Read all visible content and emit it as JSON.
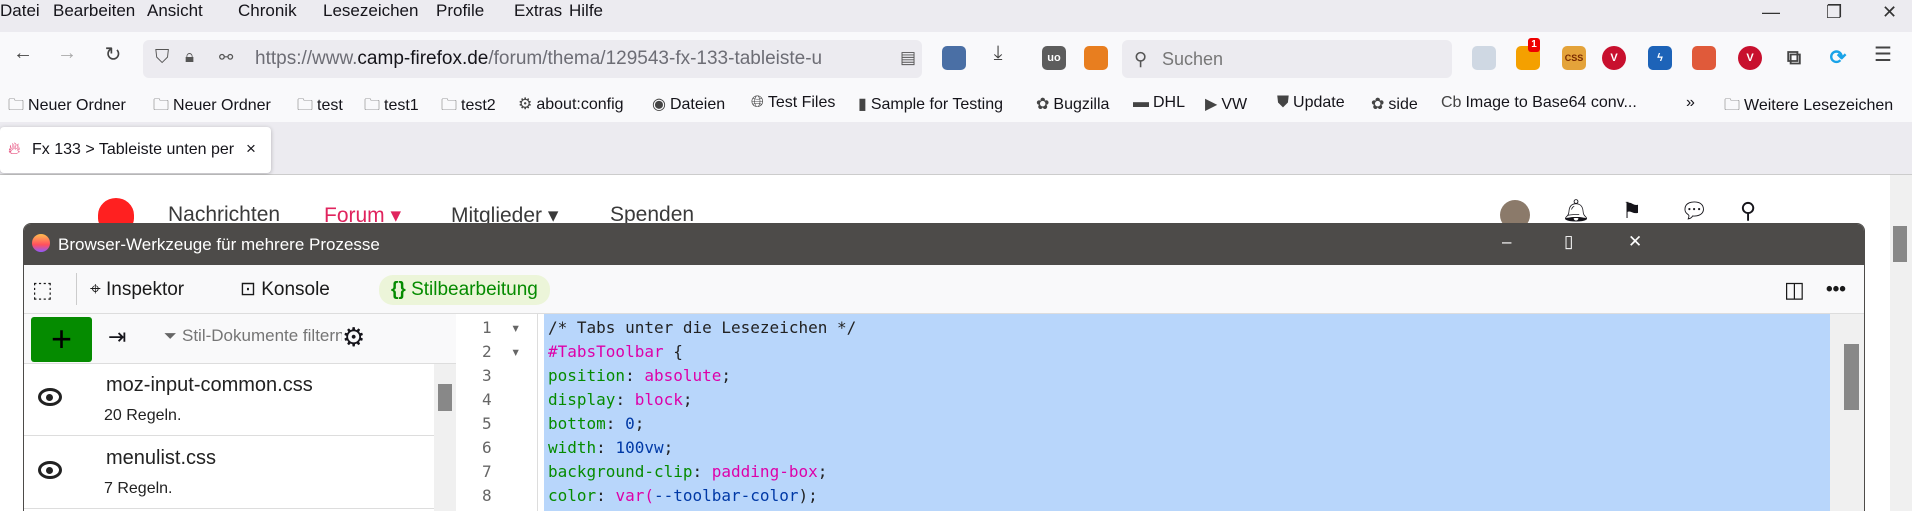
{
  "menu": [
    "Datei",
    "Bearbeiten",
    "Ansicht",
    "Chronik",
    "Lesezeichen",
    "Profile",
    "Extras",
    "Hilfe"
  ],
  "url": {
    "prefix": "https://www.",
    "host": "camp-firefox.de",
    "path": "/forum/thema/129543-fx-133-tableiste-u"
  },
  "search": {
    "placeholder": "Suchen"
  },
  "extension_badge": "1",
  "bookmarks": [
    {
      "label": "Neuer Ordner",
      "icon": "folder-icon"
    },
    {
      "label": "Neuer Ordner",
      "icon": "folder-icon"
    },
    {
      "label": "test",
      "icon": "folder-icon"
    },
    {
      "label": "test1",
      "icon": "folder-icon"
    },
    {
      "label": "test2",
      "icon": "folder-icon"
    },
    {
      "label": "about:config",
      "icon": "gear-icon"
    },
    {
      "label": "Dateien",
      "icon": "firefox-icon"
    },
    {
      "label": "Test Files",
      "icon": "globe-icon"
    },
    {
      "label": "Sample for Testing",
      "icon": "doc-icon"
    },
    {
      "label": "Bugzilla",
      "icon": "bugzilla-icon"
    },
    {
      "label": "DHL",
      "icon": "dhl-icon"
    },
    {
      "label": "VW",
      "icon": "youtube-icon"
    },
    {
      "label": "Update",
      "icon": "ublock-icon"
    },
    {
      "label": "side",
      "icon": "bugzilla-icon"
    },
    {
      "label": "Image to Base64 conv...",
      "icon": "cb-icon"
    }
  ],
  "more_bookmarks": "Weitere Lesezeichen",
  "tab": {
    "title": "Fx 133 > Tableiste unten per"
  },
  "site_nav": [
    "Nachrichten",
    "Forum ▾",
    "Mitglieder ▾",
    "Spenden"
  ],
  "devtools": {
    "title": "Browser-Werkzeuge für mehrere Prozesse",
    "tabs": [
      "Inspektor",
      "Konsole",
      "Stilbearbeitung"
    ],
    "filter_placeholder": "Stil-Dokumente filtern",
    "sheets": [
      {
        "name": "moz-input-common.css",
        "rules": "20 Regeln."
      },
      {
        "name": "menulist.css",
        "rules": "7 Regeln."
      }
    ],
    "code": [
      [
        [
          "comment",
          "/* Tabs unter die Lesezeichen */"
        ]
      ],
      [
        [
          "sel",
          "#TabsToolbar"
        ],
        [
          "punc",
          " {"
        ]
      ],
      [
        [
          "prop",
          "position"
        ],
        [
          "punc",
          ": "
        ],
        [
          "val",
          "absolute"
        ],
        [
          "punc",
          ";"
        ]
      ],
      [
        [
          "prop",
          "display"
        ],
        [
          "punc",
          ": "
        ],
        [
          "val",
          "block"
        ],
        [
          "punc",
          ";"
        ]
      ],
      [
        [
          "prop",
          "bottom"
        ],
        [
          "punc",
          ": "
        ],
        [
          "num",
          "0"
        ],
        [
          "punc",
          ";"
        ]
      ],
      [
        [
          "prop",
          "width"
        ],
        [
          "punc",
          ": "
        ],
        [
          "num",
          "100vw"
        ],
        [
          "punc",
          ";"
        ]
      ],
      [
        [
          "prop",
          "background-clip"
        ],
        [
          "punc",
          ": "
        ],
        [
          "val",
          "padding-box"
        ],
        [
          "punc",
          ";"
        ]
      ],
      [
        [
          "prop",
          "color"
        ],
        [
          "punc",
          ": "
        ],
        [
          "val",
          "var("
        ],
        [
          "num",
          "--toolbar-color"
        ],
        [
          "punc",
          ");"
        ]
      ]
    ]
  },
  "colors": {
    "accent_green": "#058b00",
    "selection": "#b8d6fb",
    "titlebar": "#4d4b49",
    "forum_red": "#e0245e"
  }
}
